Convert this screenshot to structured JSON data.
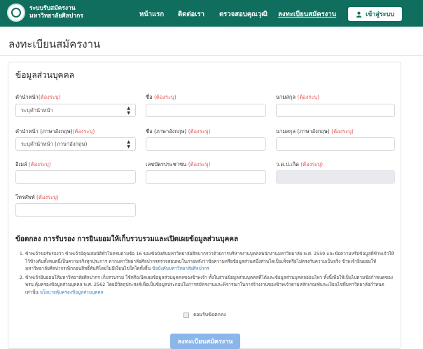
{
  "header": {
    "brand_line1": "ระบบรับสมัครงาน",
    "brand_line2": "มหาวิทยาลัยศิลปากร",
    "nav": [
      "หน้าแรก",
      "ติดต่อเรา",
      "ตรวจสอบคุณวุฒิ",
      "ลงทะเบียนสมัครงาน"
    ],
    "login_label": "เข้าสู่ระบบ"
  },
  "page_title": "ลงทะเบียนสมัครงาน",
  "section_title": "ข้อมูลส่วนบุคคล",
  "required_mark": "(ต้องระบุ)",
  "fields": {
    "title_th": {
      "label": "คำนำหน้า",
      "value": "ระบุคำนำหน้า"
    },
    "firstname_th": {
      "label": "ชื่อ",
      "value": ""
    },
    "lastname_th": {
      "label": "นามสกุล",
      "value": ""
    },
    "title_en": {
      "label": "คำนำหน้า (ภาษาอังกฤษ)",
      "value": "ระบุคำนำหน้า (ภาษาอังกฤษ)"
    },
    "firstname_en": {
      "label": "ชื่อ (ภาษาอังกฤษ)",
      "value": ""
    },
    "lastname_en": {
      "label": "นามสกุล (ภาษาอังกฤษ)",
      "value": ""
    },
    "email": {
      "label": "อีเมล์",
      "value": ""
    },
    "national_id": {
      "label": "เลขบัตรประชาชน",
      "value": ""
    },
    "birthdate": {
      "label": "ว.ด.ป.เกิด",
      "value": ""
    },
    "phone": {
      "label": "โทรศัพท์",
      "value": ""
    }
  },
  "agreement": {
    "title": "ข้อตกลง การรับรอง การยินยอมให้เก็บรวบรวมและเปิดเผยข้อมูลส่วนบุคคล",
    "item1_text": "ข้าพเจ้าขอรับรองว่า ข้าพเจ้ามีคุณสมบัติทั่วไปครบตามข้อ 16 ของข้อบังคับมหาวิทยาลัยศิลปากรว่าด้วยการบริหารงานบุคคลพนักงานมหาวิทยาลัย พ.ศ. 2559 และข้อความหรือข้อมูลที่ข้าพเจ้าให้ไว้ข้างต้นทั้งหมดนี้เป็นความจริงทุกประการ หากมหาวิทยาลัยศิลปากรตรวจสอบพบในภายหลังว่าข้อความหรือข้อมูลส่วนหนึ่งส่วนใดเป็นเท็จหรือไม่ตรงกับความเป็นจริง ข้าพเจ้ายินยอมให้มหาวิทยาลัยศิลปากรเพิกถอนสิทธิ์ทันทีโดยไม่มีเงื่อนไขใดใดทั้งสิ้น",
    "item1_link": "ข้อบังคับมหาวิทยาลัยศิลปากร",
    "item2_text": "ข้าพเจ้ายินยอมให้มหาวิทยาลัยศิลปากร เก็บรวบรวม ใช้หรือเปิดเผยข้อมูลส่วนบุคคลของข้าพเจ้า ทั้งในส่วนข้อมูลส่วนบุคคลที่ได้และข้อมูลส่วนบุคคลอ่อนไหว ทั้งนี้เพื่อให้เป็นไปตามข้อกำหนดของ พรบ.คุ้มครองข้อมูลส่วนบุคคล พ.ศ. 2562 โดยมีวัตถุประสงค์เพื่อเป็นข้อมูลประกอบในการสมัครงานและพิจารณาในการจ้างงานของข้าพเจ้าตามหลักเกณฑ์และเงื่อนไขที่มหาวิทยาลัยกำหนดเท่านั้น",
    "item2_link": "นโยบายคุ้มครองข้อมูลส่วนบุคคล",
    "accept_label": "ยอมรับข้อตกลง"
  },
  "submit_label": "ลงทะเบียนสมัครงาน"
}
